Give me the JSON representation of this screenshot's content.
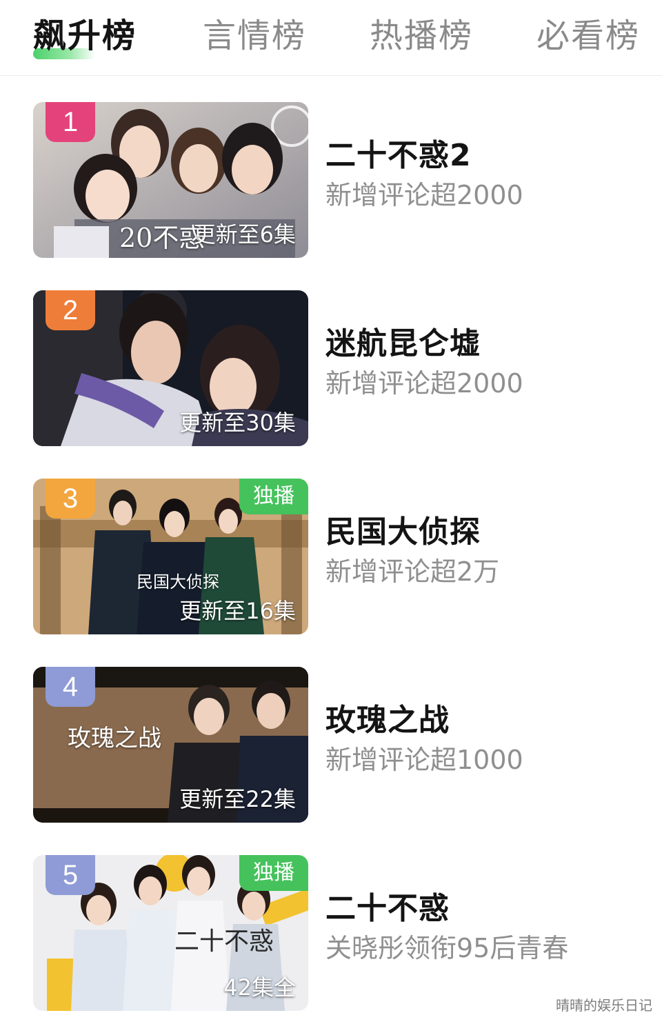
{
  "tabs": [
    {
      "label": "飙升榜",
      "active": true
    },
    {
      "label": "言情榜",
      "active": false
    },
    {
      "label": "热播榜",
      "active": false
    },
    {
      "label": "必看榜",
      "active": false
    }
  ],
  "colors": {
    "accent_green": "#45c25c",
    "rank_1": "#e3437a",
    "rank_2": "#ef7d3a",
    "rank_3": "#f2a63d",
    "rank_other": "#8e9bd6"
  },
  "items": [
    {
      "rank": "1",
      "title": "二十不惑2",
      "desc": "新增评论超2000",
      "episode": "更新至6集",
      "poster_text": "20不惑",
      "exclusive": ""
    },
    {
      "rank": "2",
      "title": "迷航昆仑墟",
      "desc": "新增评论超2000",
      "episode": "更新至30集",
      "poster_text": "",
      "exclusive": ""
    },
    {
      "rank": "3",
      "title": "民国大侦探",
      "desc": "新增评论超2万",
      "episode": "更新至16集",
      "poster_text": "民国大侦探",
      "exclusive": "独播"
    },
    {
      "rank": "4",
      "title": "玫瑰之战",
      "desc": "新增评论超1000",
      "episode": "更新至22集",
      "poster_text": "玫瑰之战",
      "exclusive": ""
    },
    {
      "rank": "5",
      "title": "二十不惑",
      "desc": "关晓彤领衔95后青春",
      "episode": "42集全",
      "poster_text": "二十不惑",
      "exclusive": "独播"
    }
  ],
  "watermark": "晴晴的娱乐日记"
}
